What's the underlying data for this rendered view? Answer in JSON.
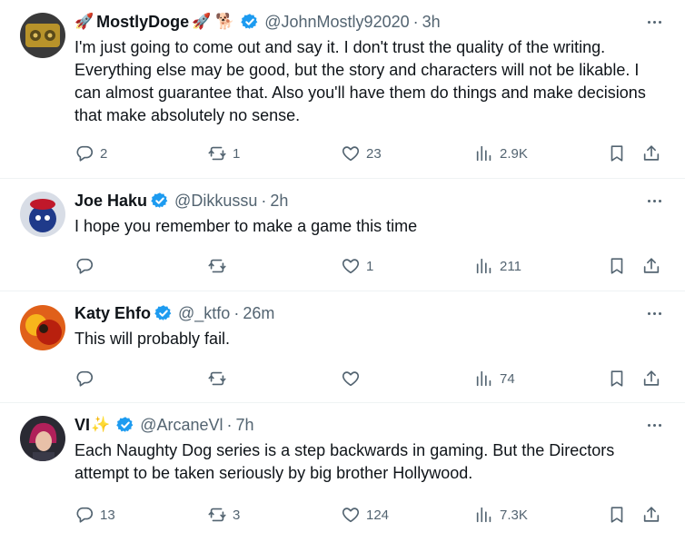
{
  "colors": {
    "accent": "#1d9bf0",
    "text": "#0f1419",
    "muted": "#536471",
    "divider": "#eff3f4"
  },
  "tweets": [
    {
      "name": "MostlyDoge",
      "name_prefix_emoji": "🚀",
      "name_suffix_emojis": "🚀 🐕",
      "handle": "@JohnMostly92020",
      "separator": "·",
      "time": "3h",
      "text": "I'm just going to come out and say it. I don't trust the quality of the writing. Everything else may be good, but the story and characters will not be likable. I can almost guarantee that. Also you'll have them do things and make decisions that make absolutely no sense.",
      "replies": "2",
      "retweets": "1",
      "likes": "23",
      "views": "2.9K"
    },
    {
      "name": "Joe Haku",
      "handle": "@Dikkussu",
      "separator": "·",
      "time": "2h",
      "text": "I hope you remember to make a game this time",
      "replies": "",
      "retweets": "",
      "likes": "1",
      "views": "211"
    },
    {
      "name": "Katy Ehfo",
      "handle": "@_ktfo",
      "separator": "·",
      "time": "26m",
      "text": "This will probably fail.",
      "replies": "",
      "retweets": "",
      "likes": "",
      "views": "74"
    },
    {
      "name": "VI",
      "name_suffix_emojis": "✨",
      "handle": "@ArcaneVl",
      "separator": "·",
      "time": "7h",
      "text": "Each Naughty Dog series is a step backwards in gaming. But the Directors attempt to be taken seriously by big brother Hollywood.",
      "replies": "13",
      "retweets": "3",
      "likes": "124",
      "views": "7.3K"
    }
  ],
  "icons": {
    "reply": "reply-icon",
    "retweet": "retweet-icon",
    "like": "heart-icon",
    "views": "views-icon",
    "bookmark": "bookmark-icon",
    "share": "share-icon",
    "verified": "verified-badge-icon",
    "more": "more-icon"
  }
}
